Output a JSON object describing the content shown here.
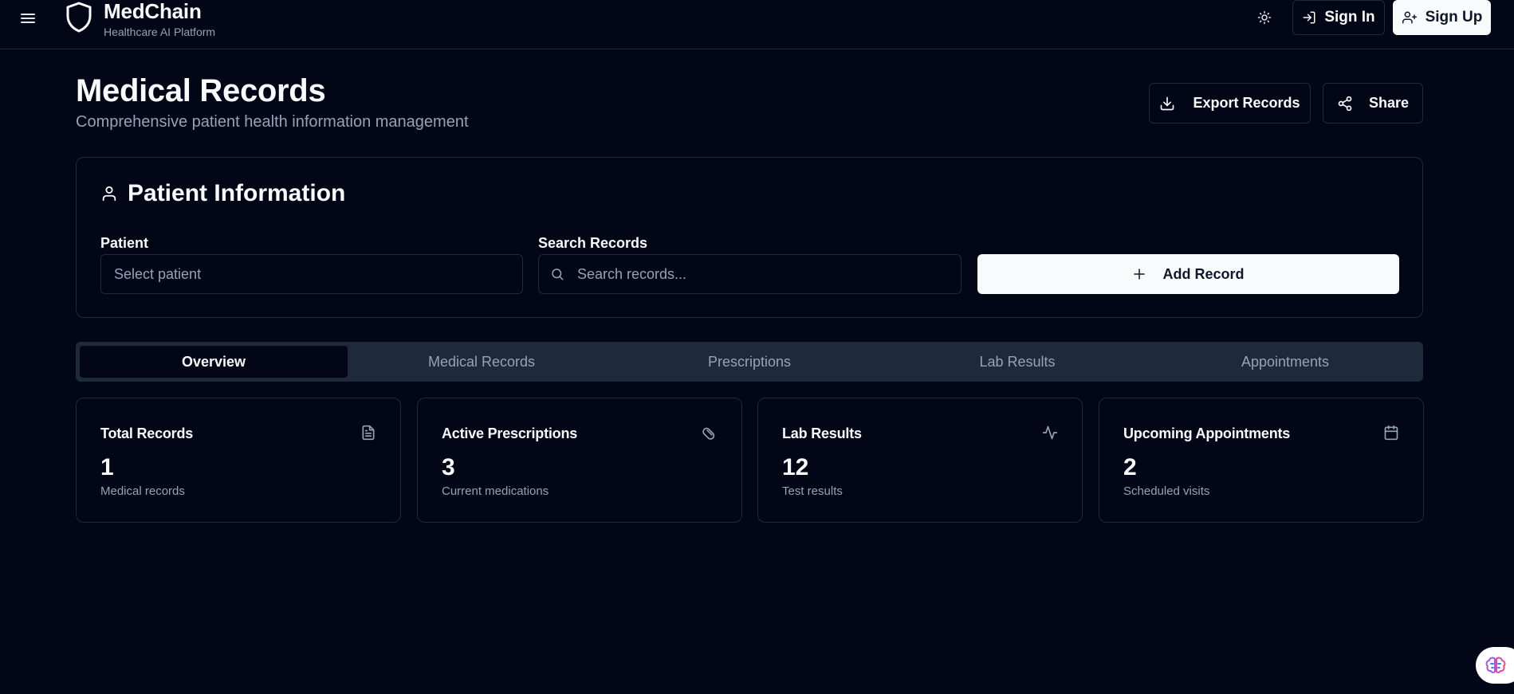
{
  "header": {
    "brand_name": "MedChain",
    "brand_subtitle": "Healthcare AI Platform",
    "sign_in_label": "Sign In",
    "sign_up_label": "Sign Up",
    "icons": [
      "menu-icon",
      "shield-icon",
      "sun-icon",
      "log-in-icon",
      "user-plus-icon"
    ]
  },
  "page": {
    "title": "Medical Records",
    "subtitle": "Comprehensive patient health information management",
    "export_label": "Export Records",
    "share_label": "Share"
  },
  "patient_card": {
    "title": "Patient Information",
    "patient_label": "Patient",
    "patient_placeholder": "Select patient",
    "search_label": "Search Records",
    "search_placeholder": "Search records...",
    "add_label": "Add Record"
  },
  "tabs": [
    {
      "label": "Overview",
      "active": true
    },
    {
      "label": "Medical Records",
      "active": false
    },
    {
      "label": "Prescriptions",
      "active": false
    },
    {
      "label": "Lab Results",
      "active": false
    },
    {
      "label": "Appointments",
      "active": false
    }
  ],
  "stats": [
    {
      "title": "Total Records",
      "value": "1",
      "desc": "Medical records",
      "icon": "file-text-icon"
    },
    {
      "title": "Active Prescriptions",
      "value": "3",
      "desc": "Current medications",
      "icon": "pill-icon"
    },
    {
      "title": "Lab Results",
      "value": "12",
      "desc": "Test results",
      "icon": "activity-icon"
    },
    {
      "title": "Upcoming Appointments",
      "value": "2",
      "desc": "Scheduled visits",
      "icon": "calendar-icon"
    }
  ],
  "colors": {
    "background": "#020617",
    "border": "#1e293b",
    "muted_text": "#94a3b8",
    "primary_button": "#f8fafc"
  }
}
